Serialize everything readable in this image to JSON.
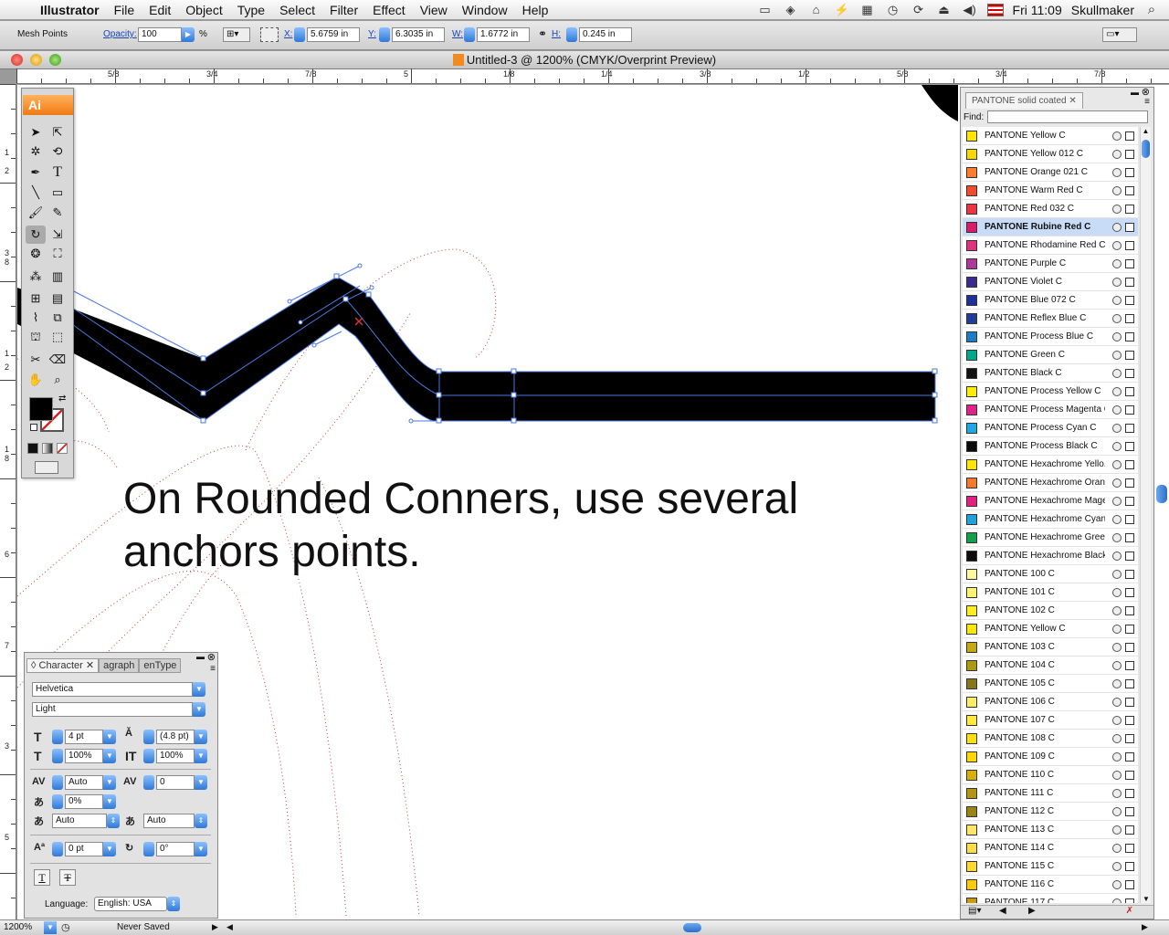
{
  "menubar": {
    "apple": "",
    "app_name": "Illustrator",
    "items": [
      "File",
      "Edit",
      "Object",
      "Type",
      "Select",
      "Filter",
      "Effect",
      "View",
      "Window",
      "Help"
    ],
    "clock": "Fri 11:09",
    "user": "Skullmaker"
  },
  "control": {
    "selection_type": "Mesh Points",
    "opacity_label": "Opacity:",
    "opacity_value": "100",
    "opacity_unit": "%",
    "x_label": "X:",
    "x_value": "5.6759 in",
    "y_label": "Y:",
    "y_value": "6.3035 in",
    "w_label": "W:",
    "w_value": "1.6772 in",
    "h_label": "H:",
    "h_value": "0.245 in"
  },
  "document": {
    "title": "Untitled-3 @ 1200% (CMYK/Overprint Preview)"
  },
  "ruler": {
    "h_labels": [
      "5/8",
      "3/4",
      "7/8",
      "5",
      "1/8",
      "1/4",
      "3/8",
      "1/2",
      "5/8",
      "3/4",
      "7/8"
    ],
    "v_labels": [
      "1",
      "2",
      "3",
      "8",
      "1",
      "2",
      "1",
      "8",
      "6",
      "7",
      "3",
      "5"
    ]
  },
  "canvas": {
    "text_line1": "On Rounded Conners, use several",
    "text_line2": "anchors points."
  },
  "tools": {
    "logo": "Ai"
  },
  "swatches": {
    "tab_label": "PANTONE solid coated",
    "find_label": "Find:",
    "items": [
      {
        "name": "PANTONE Yellow C",
        "color": "#FFE600"
      },
      {
        "name": "PANTONE Yellow 012 C",
        "color": "#FFD700"
      },
      {
        "name": "PANTONE Orange 021 C",
        "color": "#FE7E2E"
      },
      {
        "name": "PANTONE Warm Red C",
        "color": "#F24A2E"
      },
      {
        "name": "PANTONE Red 032 C",
        "color": "#EF3340"
      },
      {
        "name": "PANTONE Rubine Red C",
        "color": "#DA1A6A"
      },
      {
        "name": "PANTONE Rhodamine Red C",
        "color": "#E0307E"
      },
      {
        "name": "PANTONE Purple C",
        "color": "#B0359A"
      },
      {
        "name": "PANTONE Violet C",
        "color": "#3B2A8F"
      },
      {
        "name": "PANTONE Blue 072 C",
        "color": "#1E2E9A"
      },
      {
        "name": "PANTONE Reflex Blue C",
        "color": "#1E3E9A"
      },
      {
        "name": "PANTONE Process Blue C",
        "color": "#1C7DC7"
      },
      {
        "name": "PANTONE Green C",
        "color": "#00A788"
      },
      {
        "name": "PANTONE Black C",
        "color": "#111111"
      },
      {
        "name": "PANTONE Process Yellow C",
        "color": "#FFED00"
      },
      {
        "name": "PANTONE Process Magenta C",
        "color": "#E3218A"
      },
      {
        "name": "PANTONE Process Cyan C",
        "color": "#1EA7E6"
      },
      {
        "name": "PANTONE Process Black C",
        "color": "#0A0A0A"
      },
      {
        "name": "PANTONE Hexachrome Yello...",
        "color": "#FFE600"
      },
      {
        "name": "PANTONE Hexachrome Oran...",
        "color": "#F6782A"
      },
      {
        "name": "PANTONE Hexachrome Mage...",
        "color": "#E3207F"
      },
      {
        "name": "PANTONE Hexachrome Cyan C",
        "color": "#1FA2DC"
      },
      {
        "name": "PANTONE Hexachrome Green C",
        "color": "#12A04A"
      },
      {
        "name": "PANTONE Hexachrome Black C",
        "color": "#0D0D0D"
      },
      {
        "name": "PANTONE 100 C",
        "color": "#FFF6A0"
      },
      {
        "name": "PANTONE 101 C",
        "color": "#FFF469"
      },
      {
        "name": "PANTONE 102 C",
        "color": "#FFEC1C"
      },
      {
        "name": "PANTONE Yellow C",
        "color": "#FFE600"
      },
      {
        "name": "PANTONE 103 C",
        "color": "#C7A80E"
      },
      {
        "name": "PANTONE 104 C",
        "color": "#AE9A12"
      },
      {
        "name": "PANTONE 105 C",
        "color": "#857718"
      },
      {
        "name": "PANTONE 106 C",
        "color": "#FFEE63"
      },
      {
        "name": "PANTONE 107 C",
        "color": "#FFE93C"
      },
      {
        "name": "PANTONE 108 C",
        "color": "#FFDF0D"
      },
      {
        "name": "PANTONE 109 C",
        "color": "#FFD600"
      },
      {
        "name": "PANTONE 110 C",
        "color": "#D8AE09"
      },
      {
        "name": "PANTONE 111 C",
        "color": "#B5940F"
      },
      {
        "name": "PANTONE 112 C",
        "color": "#9B8414"
      },
      {
        "name": "PANTONE 113 C",
        "color": "#FFE46A"
      },
      {
        "name": "PANTONE 114 C",
        "color": "#FFDD4A"
      },
      {
        "name": "PANTONE 115 C",
        "color": "#FFD830"
      },
      {
        "name": "PANTONE 116 C",
        "color": "#FFCC00"
      },
      {
        "name": "PANTONE 117 C",
        "color": "#C99A0C"
      }
    ]
  },
  "character": {
    "tab_character": "Character",
    "tab_paragraph": "agraph",
    "tab_opentype": "enType",
    "font_family": "Helvetica",
    "font_style": "Light",
    "font_size": "4 pt",
    "leading": "(4.8 pt)",
    "horiz_scale": "100%",
    "vert_scale": "100%",
    "kerning": "Auto",
    "tracking": "0",
    "tsume": "0%",
    "aki_left": "Auto",
    "aki_right": "Auto",
    "baseline_shift": "0 pt",
    "rotation": "0°",
    "language_label": "Language:",
    "language": "English: USA"
  },
  "status": {
    "zoom": "1200%",
    "save_state": "Never Saved"
  }
}
